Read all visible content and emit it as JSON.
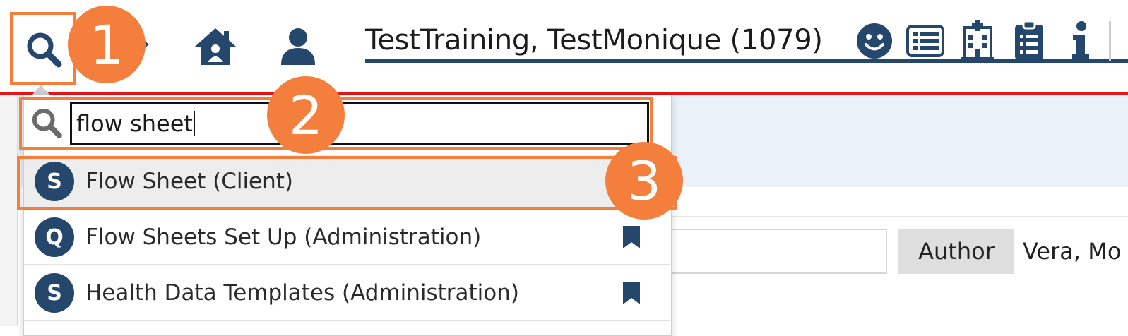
{
  "header": {
    "patient_name": "TestTraining, TestMonique (1079)",
    "icons": [
      "search-icon",
      "home-icon",
      "user-icon",
      "smiley-icon",
      "list-icon",
      "hospital-icon",
      "clipboard-icon",
      "info-icon"
    ]
  },
  "search": {
    "query": "flow sheet",
    "results": [
      {
        "badge": "S",
        "label": "Flow Sheet (Client)",
        "bookmark": false
      },
      {
        "badge": "Q",
        "label": "Flow Sheets Set Up (Administration)",
        "bookmark": true
      },
      {
        "badge": "S",
        "label": "Health Data Templates (Administration)",
        "bookmark": true
      }
    ]
  },
  "form": {
    "author_label": "Author",
    "author_value": "Vera, Mo"
  },
  "annotations": {
    "step1": "1",
    "step2": "2",
    "step3": "3",
    "color": "#f47f3d"
  },
  "colors": {
    "brand": "#25476b",
    "accent_line": "#e8161b"
  }
}
